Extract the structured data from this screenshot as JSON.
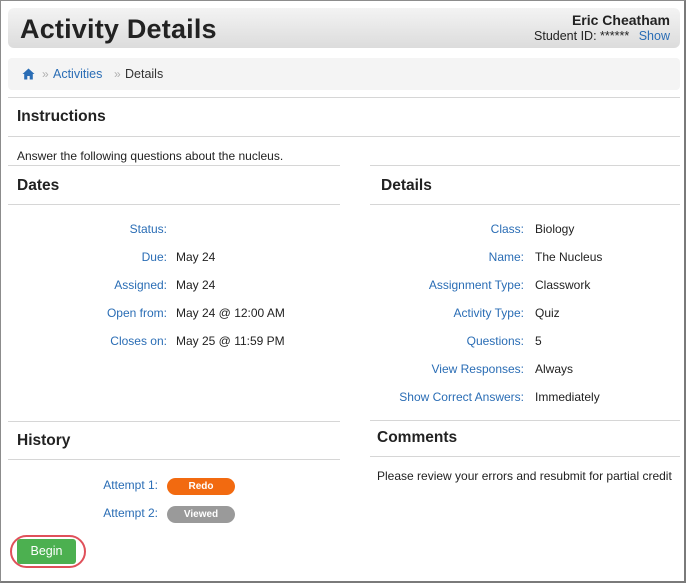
{
  "header": {
    "title": "Activity Details",
    "user_name": "Eric Cheatham",
    "student_id_label": "Student ID:",
    "student_id_value": "******",
    "show_label": "Show"
  },
  "breadcrumb": {
    "home_icon": "home-icon",
    "separator": "»",
    "items": [
      {
        "label": "Activities"
      },
      {
        "label": "Details"
      }
    ]
  },
  "instructions": {
    "heading": "Instructions",
    "text": "Answer the following questions about the nucleus."
  },
  "dates": {
    "heading": "Dates",
    "rows": [
      {
        "label": "Status:",
        "value": ""
      },
      {
        "label": "Due:",
        "value": "May 24"
      },
      {
        "label": "Assigned:",
        "value": "May 24"
      },
      {
        "label": "Open from:",
        "value": "May 24 @ 12:00 AM"
      },
      {
        "label": "Closes on:",
        "value": "May 25 @ 11:59 PM"
      }
    ]
  },
  "details": {
    "heading": "Details",
    "rows": [
      {
        "label": "Class:",
        "value": "Biology"
      },
      {
        "label": "Name:",
        "value": "The Nucleus"
      },
      {
        "label": "Assignment Type:",
        "value": "Classwork"
      },
      {
        "label": "Activity Type:",
        "value": "Quiz"
      },
      {
        "label": "Questions:",
        "value": "5"
      },
      {
        "label": "View Responses:",
        "value": "Always"
      },
      {
        "label": "Show Correct Answers:",
        "value": "Immediately"
      }
    ]
  },
  "history": {
    "heading": "History",
    "attempts": [
      {
        "label": "Attempt 1:",
        "badge": "Redo"
      },
      {
        "label": "Attempt 2:",
        "badge": "Viewed"
      }
    ]
  },
  "comments": {
    "heading": "Comments",
    "text": "Please review your errors and resubmit for partial credit"
  },
  "actions": {
    "begin_label": "Begin"
  },
  "colors": {
    "link": "#2a6db5",
    "redo_badge": "#f26a10",
    "viewed_badge": "#9a9a9a",
    "begin_button": "#4cb050",
    "highlight_ring": "#e0505a"
  }
}
